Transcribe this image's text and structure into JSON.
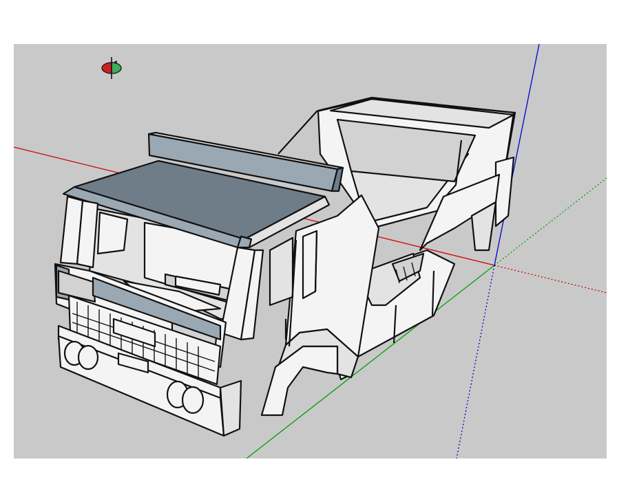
{
  "viewport": {
    "background": "#c9c9c9",
    "active_tool": "orbit-tool"
  },
  "axes": {
    "red": "#cc0000",
    "green": "#00a000",
    "blue": "#0000cc"
  },
  "model": {
    "name": "truck-cab-model"
  },
  "cursor": {
    "icon": "orbit-icon"
  }
}
